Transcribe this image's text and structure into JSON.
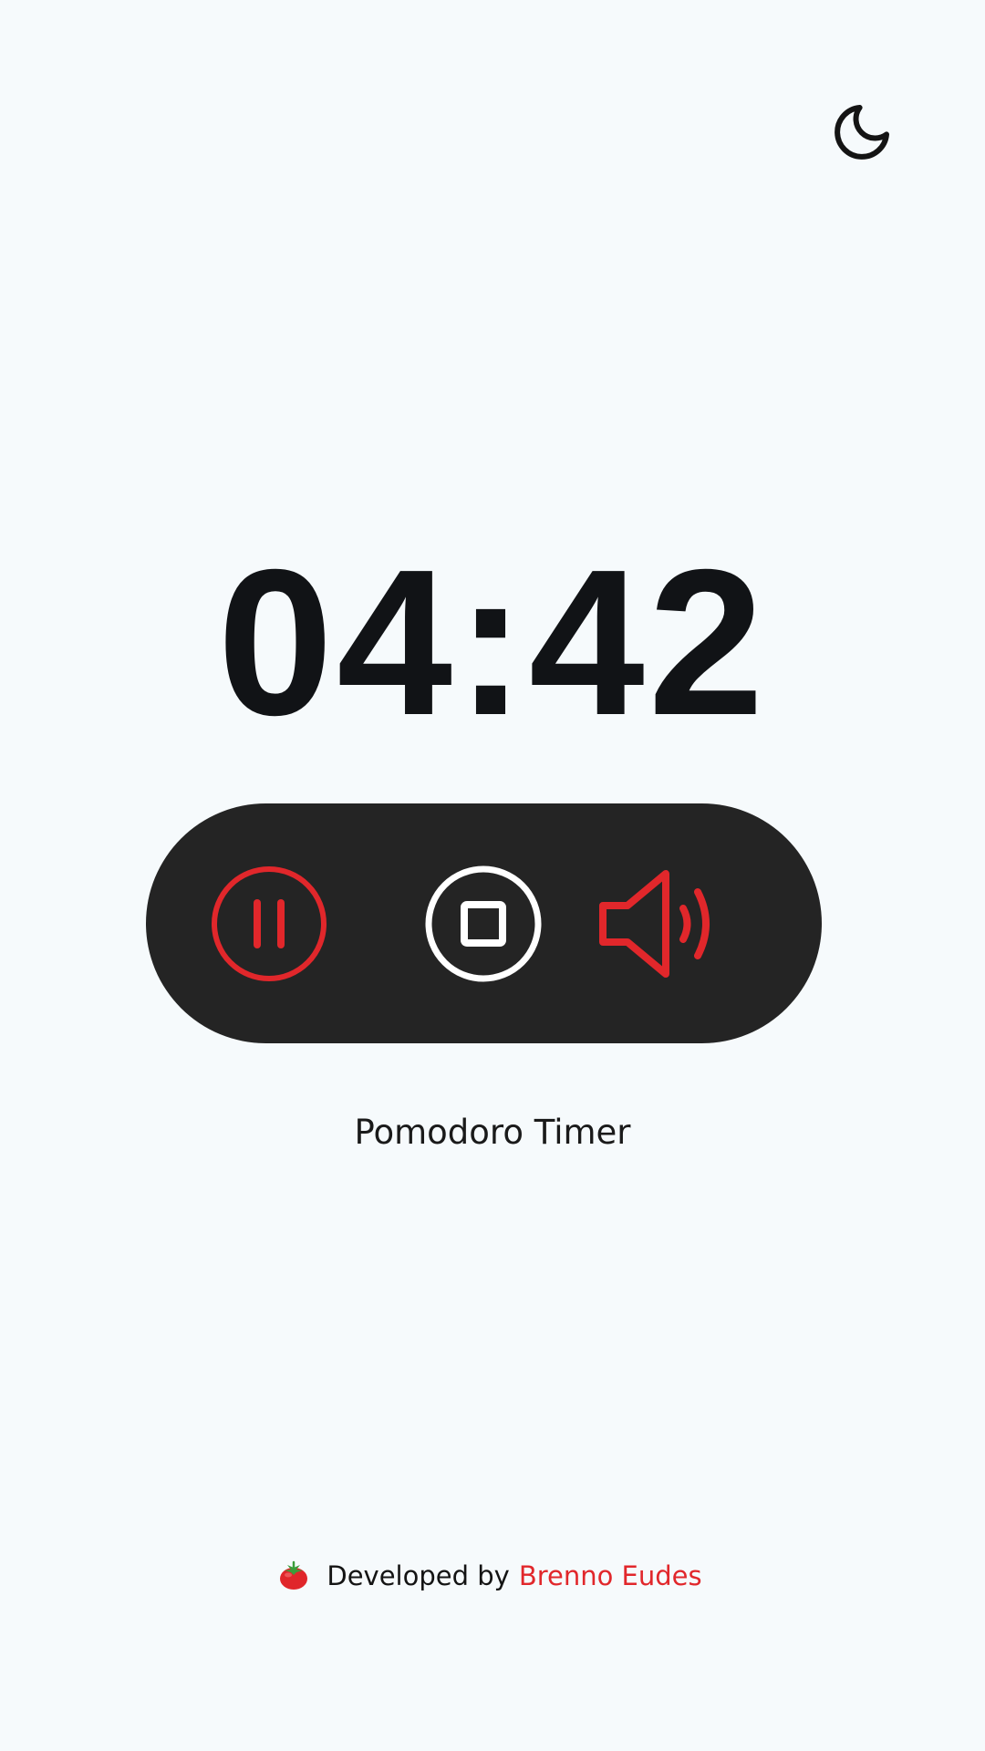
{
  "timer": {
    "display": "04:42"
  },
  "header": {
    "theme_toggle_icon": "moon-icon"
  },
  "controls": {
    "pause_icon": "pause-circle-icon",
    "stop_icon": "stop-circle-icon",
    "sound_icon": "volume-icon"
  },
  "app": {
    "title": "Pomodoro Timer"
  },
  "footer": {
    "icon": "tomato-icon",
    "prefix": "Developed by",
    "author": "Brenno Eudes"
  },
  "colors": {
    "background": "#f6fafc",
    "accent": "#e1272b",
    "controls_background": "#242424",
    "timer_text": "#111316"
  }
}
